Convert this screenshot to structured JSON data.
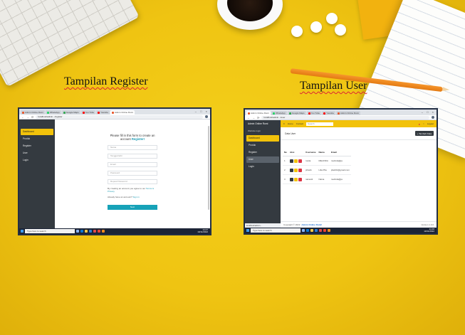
{
  "captions": {
    "register": "Tampilan Register",
    "user": "Tampilan User"
  },
  "register_shot": {
    "tabs": [
      "Admin Online Rumi",
      "WhatsApp",
      "Google Maps",
      "You Tube",
      "Youtube",
      "Admin Online Rumi"
    ],
    "url": "localhost/admin.../register",
    "sidebar": [
      "Dashboard",
      "Produk",
      "Register",
      "User",
      "Login"
    ],
    "form": {
      "title_line1": "Please fill in this form to create an",
      "title_line2_prefix": "account",
      "title_link": "Register!",
      "fields": [
        "Nama",
        "Tanggal lahir",
        "Email",
        "Password",
        "Repeat Password"
      ],
      "terms": "By creating an account you agree to our",
      "terms_link": "Terms & Privacy",
      "signin": "Already have an account?",
      "signin_link": "Sign in",
      "button": "Next"
    },
    "taskbar": {
      "search": "Type here to search",
      "time": "14:47",
      "date": "10/11/2022"
    }
  },
  "user_shot": {
    "tabs": [
      "Admin Online Rumi",
      "WhatsApp",
      "Google Maps",
      "You Tube",
      "Youtube",
      "Admin Online Rumi"
    ],
    "url": "localhost/admin.../user",
    "sidebar": {
      "brand": "Admin Online Rumi",
      "sub": "Website login",
      "items": [
        "Dashboard",
        "Produk",
        "Register",
        "User",
        "Login"
      ]
    },
    "topbar": {
      "home": "Home",
      "contact": "Contact",
      "search_placeholder": "Search",
      "logout": "Logout"
    },
    "content": {
      "title": "Data User",
      "add_button": "+ Tambah Data",
      "columns": [
        "No",
        "Aksi",
        "Username",
        "Nama",
        "Email"
      ],
      "rows": [
        {
          "no": "1",
          "username": "rosita",
          "nama": "MELINDA",
          "email": "melinda@ja"
        },
        {
          "no": "2",
          "username": "phia11",
          "nama": "Lilia Plia",
          "email": "plieli01@gmail.com"
        },
        {
          "no": "3",
          "username": "naina11",
          "nama": "Naina",
          "email": "melinda@ja"
        }
      ]
    },
    "footer": {
      "copyright": "Copyright © 2022",
      "brand": "Admin Online Rumi!",
      "version": "Version 1.0.0"
    },
    "status_link": "localhost/admin...",
    "taskbar": {
      "search": "Type here to search",
      "time": "14:48",
      "date": "10/11/2022"
    }
  },
  "colors": {
    "accent": "#f2c20a",
    "sidebar": "#343a40",
    "teal": "#17a2b8",
    "danger": "#dc3545"
  }
}
